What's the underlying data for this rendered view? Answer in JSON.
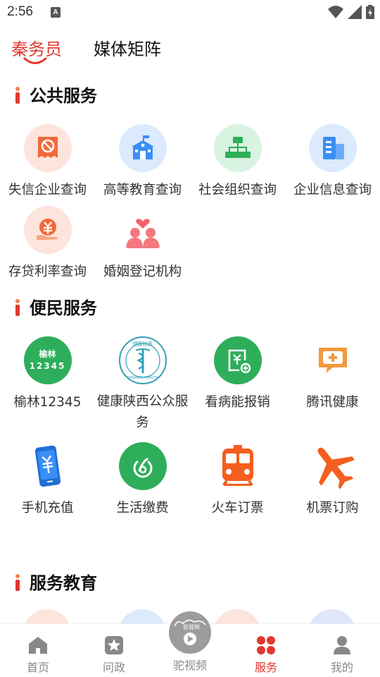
{
  "status_bar": {
    "time": "2:56",
    "notification_icon": "A"
  },
  "top_tabs": [
    {
      "label": "秦务员",
      "active": true
    },
    {
      "label": "媒体矩阵",
      "active": false
    }
  ],
  "sections": {
    "public": {
      "title": "公共服务"
    },
    "convenience": {
      "title": "便民服务"
    },
    "education": {
      "title": "服务教育"
    }
  },
  "public_services": [
    {
      "label": "失信企业查询",
      "icon": "dishonest-icon"
    },
    {
      "label": "高等教育查询",
      "icon": "school-icon"
    },
    {
      "label": "社会组织查询",
      "icon": "org-chart-icon"
    },
    {
      "label": "企业信息查询",
      "icon": "building-icon"
    },
    {
      "label": "存贷利率查询",
      "icon": "yuan-hand-icon"
    },
    {
      "label": "婚姻登记机构",
      "icon": "couple-heart-icon"
    }
  ],
  "convenience_services": [
    {
      "label": "榆林12345",
      "icon": "yulin-12345-icon",
      "badge_line1": "榆林",
      "badge_line2": "12345"
    },
    {
      "label": "健康陕西公众服务",
      "icon": "health-shaanxi-icon",
      "badge_line1": "健康陕西",
      "badge_line2": "SHAANXI HEALTH"
    },
    {
      "label": "看病能报销",
      "icon": "medical-reimburse-icon"
    },
    {
      "label": "腾讯健康",
      "icon": "tencent-health-icon"
    },
    {
      "label": "手机充值",
      "icon": "phone-recharge-icon"
    },
    {
      "label": "生活缴费",
      "icon": "life-payment-icon"
    },
    {
      "label": "火车订票",
      "icon": "train-icon"
    },
    {
      "label": "机票订购",
      "icon": "airplane-icon"
    }
  ],
  "bottom_nav": [
    {
      "label": "首页",
      "icon": "home-icon",
      "active": false
    },
    {
      "label": "问政",
      "icon": "star-icon",
      "active": false
    },
    {
      "label": "驼视频",
      "icon": "video-play-icon",
      "active": false,
      "badge": "驼视频"
    },
    {
      "label": "服务",
      "icon": "service-grid-icon",
      "active": true
    },
    {
      "label": "我的",
      "icon": "user-icon",
      "active": false
    }
  ],
  "colors": {
    "accent": "#e2382e",
    "green": "#2eae5a",
    "orange": "#f55e1e",
    "blue": "#3a8ef6"
  }
}
